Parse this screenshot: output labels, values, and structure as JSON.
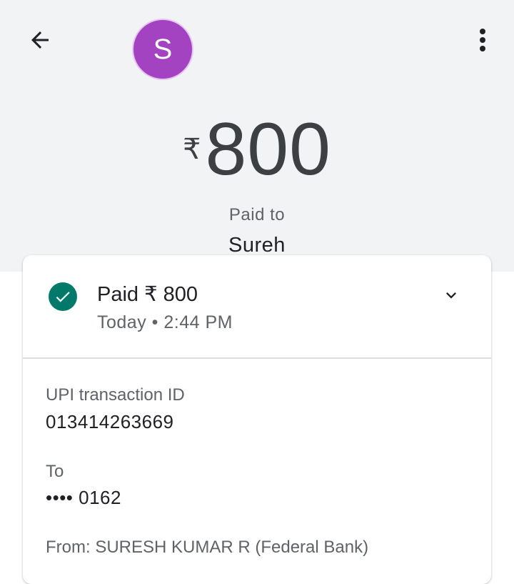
{
  "header": {
    "avatar_letter": "S",
    "avatar_color": "#a443c1"
  },
  "payment": {
    "currency_symbol": "₹",
    "amount": "800",
    "paid_to_label": "Paid to",
    "payee_name": "Sureh"
  },
  "status": {
    "title": "Paid ₹ 800",
    "time": "Today • 2:44 PM",
    "icon": "check-circle-icon",
    "icon_color": "#00796b"
  },
  "details": {
    "upi_label": "UPI transaction ID",
    "upi_value": "013414263669",
    "to_label": "To",
    "to_value": "•••• 0162",
    "from_text": "From: SURESH KUMAR R (Federal Bank)"
  }
}
